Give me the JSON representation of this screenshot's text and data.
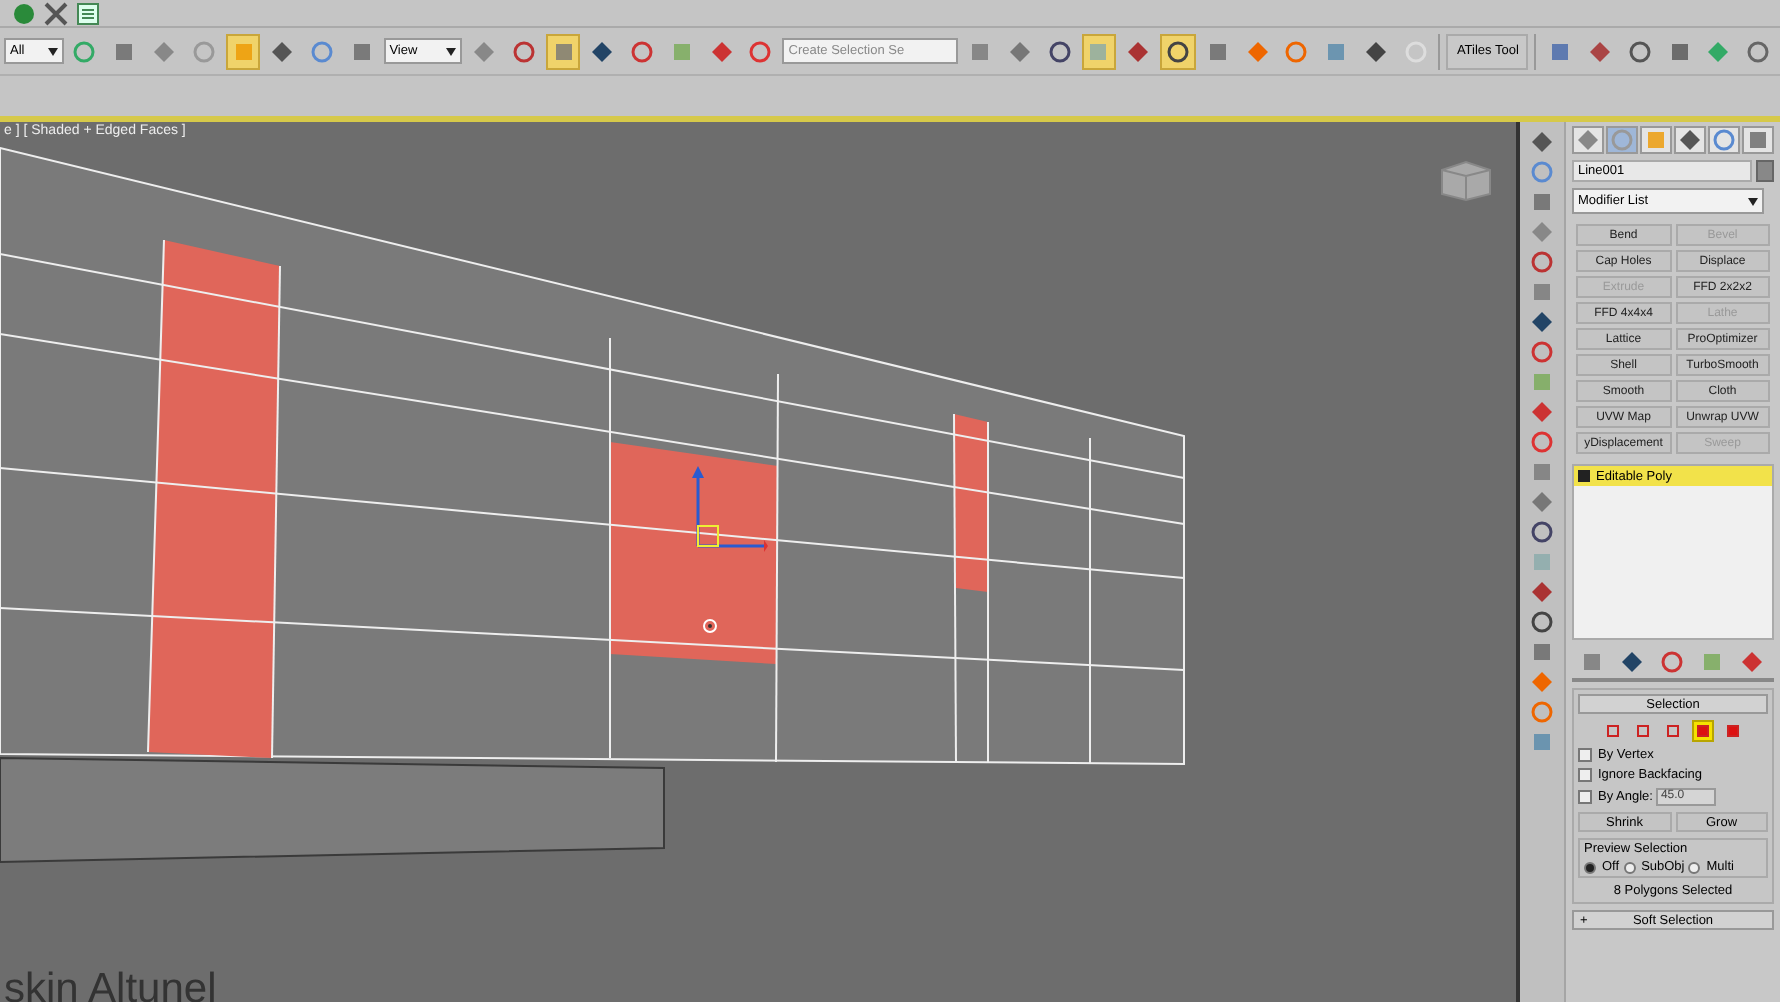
{
  "toolbar": [
    {
      "kind": "dropdown",
      "value": "All"
    },
    {
      "kind": "tool",
      "selected": false
    },
    {
      "kind": "tool",
      "selected": false
    },
    {
      "kind": "tool",
      "selected": false
    },
    {
      "kind": "tool",
      "selected": false
    },
    {
      "kind": "tool",
      "selected": true
    },
    {
      "kind": "tool",
      "selected": false
    },
    {
      "kind": "tool",
      "selected": false
    },
    {
      "kind": "tool",
      "selected": false
    },
    {
      "kind": "dropdown",
      "value": "View"
    },
    {
      "kind": "tool",
      "selected": false
    },
    {
      "kind": "tool",
      "selected": false
    },
    {
      "kind": "tool",
      "selected": true
    },
    {
      "kind": "tool",
      "selected": false
    },
    {
      "kind": "tool",
      "selected": false
    },
    {
      "kind": "tool",
      "selected": false
    },
    {
      "kind": "tool",
      "selected": false
    },
    {
      "kind": "tool",
      "selected": false
    },
    {
      "kind": "field",
      "placeholder": "Create Selection Se"
    },
    {
      "kind": "tool",
      "selected": false
    },
    {
      "kind": "tool",
      "selected": false
    },
    {
      "kind": "tool",
      "selected": false
    },
    {
      "kind": "tool",
      "selected": true
    },
    {
      "kind": "tool",
      "selected": false
    },
    {
      "kind": "tool",
      "selected": true
    },
    {
      "kind": "tool",
      "selected": false
    },
    {
      "kind": "tool",
      "selected": false
    },
    {
      "kind": "tool",
      "selected": false
    },
    {
      "kind": "tool",
      "selected": false
    },
    {
      "kind": "tool",
      "selected": false
    },
    {
      "kind": "tool",
      "selected": false
    },
    {
      "kind": "button",
      "label": "ATiles Tool"
    },
    {
      "kind": "tool",
      "selected": false
    },
    {
      "kind": "tool",
      "selected": false
    },
    {
      "kind": "tool",
      "selected": false
    },
    {
      "kind": "tool",
      "selected": false
    },
    {
      "kind": "tool",
      "selected": false
    },
    {
      "kind": "tool",
      "selected": false
    }
  ],
  "viewport": {
    "label": "e ] [ Shaded + Edged Faces ]",
    "caption": "skin Altunel"
  },
  "command_panel": {
    "tabs": [
      {
        "selected": false
      },
      {
        "selected": true
      },
      {
        "selected": false
      },
      {
        "selected": false
      },
      {
        "selected": false
      },
      {
        "selected": false
      }
    ],
    "object_name": "Line001",
    "modifier_list": "Modifier List",
    "modifiers": [
      {
        "label": "Bend",
        "disabled": false
      },
      {
        "label": "Bevel",
        "disabled": true
      },
      {
        "label": "Cap Holes",
        "disabled": false
      },
      {
        "label": "Displace",
        "disabled": false
      },
      {
        "label": "Extrude",
        "disabled": true
      },
      {
        "label": "FFD 2x2x2",
        "disabled": false
      },
      {
        "label": "FFD 4x4x4",
        "disabled": false
      },
      {
        "label": "Lathe",
        "disabled": true
      },
      {
        "label": "Lattice",
        "disabled": false
      },
      {
        "label": "ProOptimizer",
        "disabled": false
      },
      {
        "label": "Shell",
        "disabled": false
      },
      {
        "label": "TurboSmooth",
        "disabled": false
      },
      {
        "label": "Smooth",
        "disabled": false
      },
      {
        "label": "Cloth",
        "disabled": false
      },
      {
        "label": "UVW Map",
        "disabled": false
      },
      {
        "label": "Unwrap UVW",
        "disabled": false
      },
      {
        "label": "yDisplacement",
        "disabled": false
      },
      {
        "label": "Sweep",
        "disabled": true
      }
    ],
    "stack": [
      {
        "label": "Editable Poly",
        "selected": true
      }
    ],
    "selection": {
      "title": "Selection",
      "subobjects": [
        {
          "selected": false
        },
        {
          "selected": false
        },
        {
          "selected": false
        },
        {
          "selected": true
        },
        {
          "selected": false
        }
      ],
      "checks": [
        {
          "label": "By Vertex",
          "checked": false
        },
        {
          "label": "Ignore Backfacing",
          "checked": false
        }
      ],
      "by_angle": {
        "label": "By Angle:",
        "checked": false,
        "value": "45.0"
      },
      "buttons": [
        "Shrink",
        "Grow"
      ],
      "preview_title": "Preview Selection",
      "preview": [
        {
          "label": "Off",
          "selected": true
        },
        {
          "label": "SubObj",
          "selected": false
        },
        {
          "label": "Multi",
          "selected": false
        }
      ],
      "status": "8 Polygons Selected"
    },
    "soft_selection": {
      "sign": "+",
      "title": "Soft Selection"
    }
  }
}
